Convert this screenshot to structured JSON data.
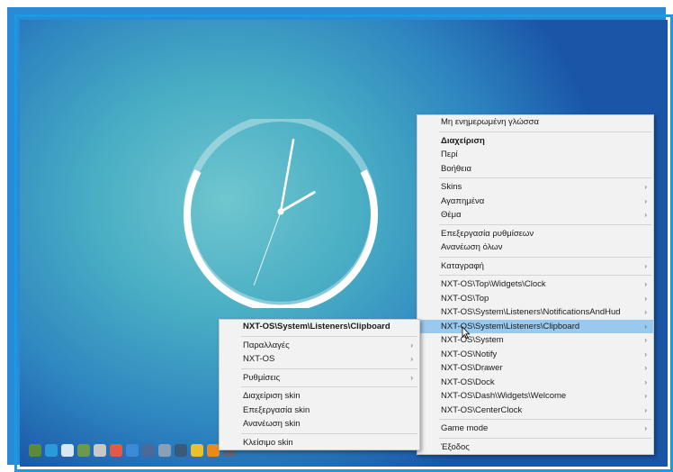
{
  "main_menu": {
    "items": [
      {
        "label": "Μη ενημερωμένη γλώσσα",
        "arrow": false,
        "bold": false,
        "sep_after": true
      },
      {
        "label": "Διαχείριση",
        "arrow": false,
        "bold": true
      },
      {
        "label": "Περί",
        "arrow": false
      },
      {
        "label": "Βοήθεια",
        "arrow": false,
        "sep_after": true
      },
      {
        "label": "Skins",
        "arrow": true
      },
      {
        "label": "Αγαπημένα",
        "arrow": true
      },
      {
        "label": "Θέμα",
        "arrow": true,
        "sep_after": true
      },
      {
        "label": "Επεξεργασία ρυθμίσεων",
        "arrow": false
      },
      {
        "label": "Ανανέωση όλων",
        "arrow": false,
        "sep_after": true
      },
      {
        "label": "Καταγραφή",
        "arrow": true,
        "sep_after": true
      },
      {
        "label": "NXT-OS\\Top\\Widgets\\Clock",
        "arrow": true
      },
      {
        "label": "NXT-OS\\Top",
        "arrow": true
      },
      {
        "label": "NXT-OS\\System\\Listeners\\NotificationsAndHud",
        "arrow": true
      },
      {
        "label": "NXT-OS\\System\\Listeners\\Clipboard",
        "arrow": true,
        "highlight": true
      },
      {
        "label": "NXT-OS\\System",
        "arrow": true
      },
      {
        "label": "NXT-OS\\Notify",
        "arrow": true
      },
      {
        "label": "NXT-OS\\Drawer",
        "arrow": true
      },
      {
        "label": "NXT-OS\\Dock",
        "arrow": true
      },
      {
        "label": "NXT-OS\\Dash\\Widgets\\Welcome",
        "arrow": true
      },
      {
        "label": "NXT-OS\\CenterClock",
        "arrow": true,
        "sep_after": true
      },
      {
        "label": "Game mode",
        "arrow": true,
        "sep_after": true
      },
      {
        "label": "Έξοδος",
        "arrow": false
      }
    ]
  },
  "sub_menu": {
    "items": [
      {
        "label": "NXT-OS\\System\\Listeners\\Clipboard",
        "arrow": false,
        "bold": true,
        "sep_after": true
      },
      {
        "label": "Παραλλαγές",
        "arrow": true
      },
      {
        "label": "NXT-OS",
        "arrow": true,
        "sep_after": true
      },
      {
        "label": "Ρυθμίσεις",
        "arrow": true,
        "sep_after": true
      },
      {
        "label": "Διαχείριση skin",
        "arrow": false
      },
      {
        "label": "Επεξεργασία skin",
        "arrow": false
      },
      {
        "label": "Ανανέωση skin",
        "arrow": false,
        "sep_after": true
      },
      {
        "label": "Κλείσιμο skin",
        "arrow": false
      }
    ]
  },
  "clock": {
    "hour_hand_angle_deg": 60,
    "minute_hand_angle_deg": 10,
    "second_hand_angle_deg": 200
  },
  "taskbar_icons": [
    {
      "name": "app-icon",
      "color": "#5a8a3a"
    },
    {
      "name": "windows-icon",
      "color": "#2a9ad8"
    },
    {
      "name": "drop-icon",
      "color": "#d8e8f0"
    },
    {
      "name": "globe-icon",
      "color": "#6a9a4a"
    },
    {
      "name": "recycle-icon",
      "color": "#c8c8c8"
    },
    {
      "name": "store-icon",
      "color": "#e05a4a"
    },
    {
      "name": "chrome-icon",
      "color": "#3a8ad8"
    },
    {
      "name": "gear-icon",
      "color": "#4a6a9a"
    },
    {
      "name": "box-icon",
      "color": "#8aa0b8"
    },
    {
      "name": "tools-icon",
      "color": "#3a5a7a"
    },
    {
      "name": "media-icon",
      "color": "#e8c030"
    },
    {
      "name": "vlc-icon",
      "color": "#e88a20"
    },
    {
      "name": "settings-icon",
      "color": "#5a6a7a"
    }
  ],
  "colors": {
    "highlight": "#99c9ef",
    "menu_bg": "#f2f2f2"
  }
}
